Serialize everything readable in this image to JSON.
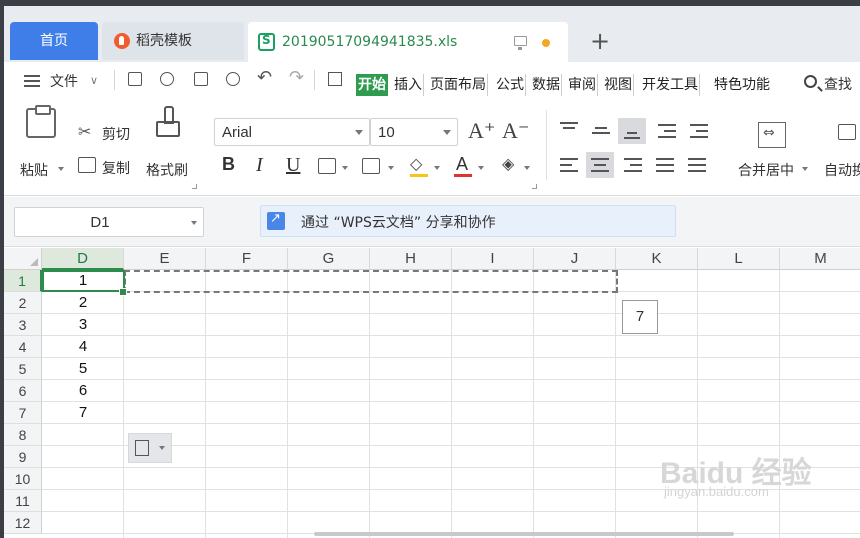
{
  "tabs": {
    "home": "首页",
    "templates": "稻壳模板",
    "file": "20190517094941835.xls"
  },
  "menu": {
    "file": "文件",
    "ribbon_tabs": [
      "开始",
      "插入",
      "页面布局",
      "公式",
      "数据",
      "审阅",
      "视图",
      "开发工具",
      "特色功能"
    ],
    "search": "查找"
  },
  "ribbon": {
    "paste": "粘贴",
    "cut": "剪切",
    "copy": "复制",
    "format_painter": "格式刷",
    "font_name": "Arial",
    "font_size": "10",
    "bold": "B",
    "italic": "I",
    "underline": "U",
    "font_color_letter": "A",
    "font_color": "#e03030",
    "fill_color": "#f5c518",
    "merge_center": "合并居中",
    "auto_wrap": "自动换"
  },
  "formula_bar": {
    "name_box": "D1",
    "share_text": "通过 “WPS云文档” 分享和协作"
  },
  "sheet": {
    "columns": [
      "D",
      "E",
      "F",
      "G",
      "H",
      "I",
      "J",
      "K",
      "L",
      "M"
    ],
    "rows": [
      "1",
      "2",
      "3",
      "4",
      "5",
      "6",
      "7",
      "8",
      "9",
      "10",
      "11",
      "12"
    ],
    "d_values": [
      "1",
      "2",
      "3",
      "4",
      "5",
      "6",
      "7"
    ],
    "count_tooltip": "7",
    "selected_cell": "D1",
    "accent_color": "#2e8b4e"
  },
  "watermark": {
    "brand": "Baidu 经验",
    "url": "jingyan.baidu.com"
  }
}
